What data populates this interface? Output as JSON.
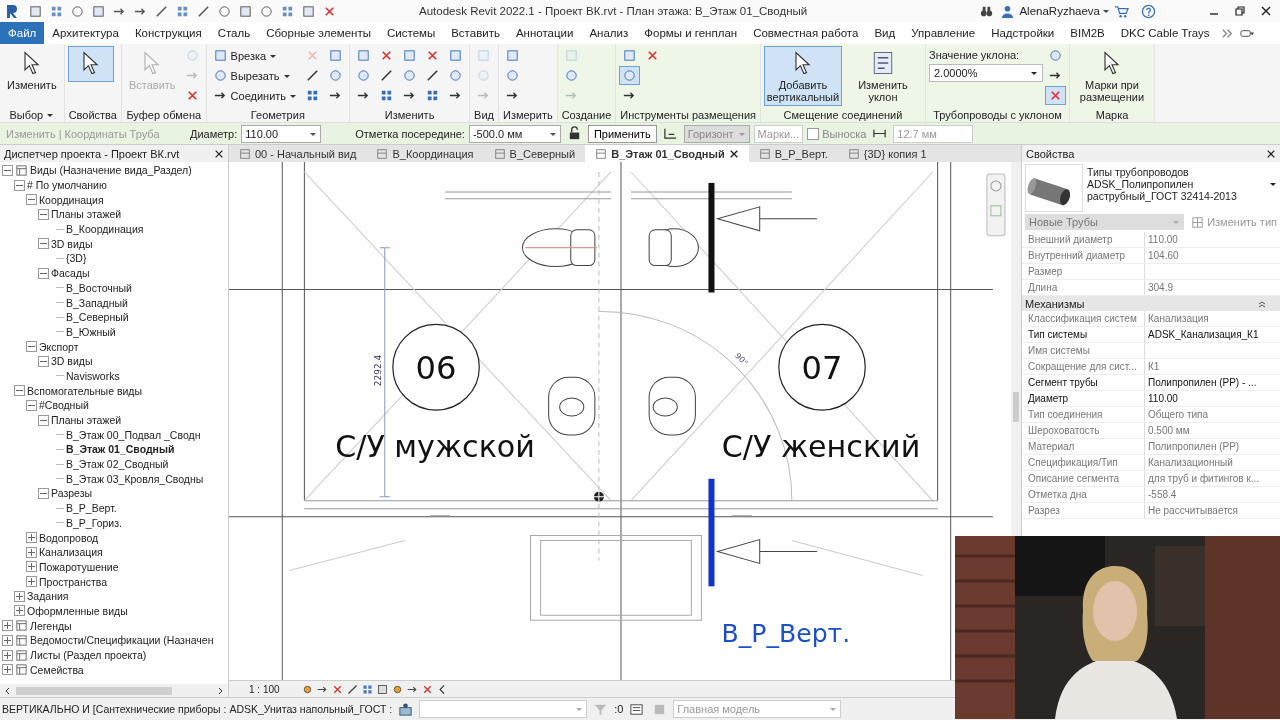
{
  "title_bar": {
    "title": "Autodesk Revit 2022.1 - Проект ВК.rvt - План этажа: В_Этаж 01_Сводный",
    "user": "AlenaRyzhaeva"
  },
  "menu_tabs": [
    {
      "label": "Файл",
      "selected": true
    },
    {
      "label": "Архитектура",
      "selected": false
    },
    {
      "label": "Конструкция",
      "selected": false
    },
    {
      "label": "Сталь",
      "selected": false
    },
    {
      "label": "Сборные элементы",
      "selected": false
    },
    {
      "label": "Системы",
      "selected": false
    },
    {
      "label": "Вставить",
      "selected": false
    },
    {
      "label": "Аннотации",
      "selected": false
    },
    {
      "label": "Анализ",
      "selected": false
    },
    {
      "label": "Формы и генплан",
      "selected": false
    },
    {
      "label": "Совместная работа",
      "selected": false
    },
    {
      "label": "Вид",
      "selected": false
    },
    {
      "label": "Управление",
      "selected": false
    },
    {
      "label": "Надстройки",
      "selected": false
    },
    {
      "label": "BIM2B",
      "selected": false
    },
    {
      "label": "DKC Cable Trays",
      "selected": false
    }
  ],
  "ribbon": {
    "panels": [
      {
        "label": "Выбор",
        "menu": true,
        "contextual": false,
        "tools": [
          {
            "kind": "large",
            "label": "Изменить",
            "selected": false,
            "disabled": false
          }
        ]
      },
      {
        "label": "Свойства",
        "menu": false,
        "contextual": false,
        "tools": [
          {
            "kind": "large",
            "selected": true,
            "disabled": false
          }
        ]
      },
      {
        "label": "Буфер обмена",
        "menu": false,
        "contextual": false,
        "tools": [
          {
            "kind": "large",
            "label": "Вставить",
            "selected": false,
            "disabled": true
          },
          {
            "kind": "icon",
            "selected": false,
            "disabled": true
          },
          {
            "kind": "icon",
            "selected": false,
            "disabled": true
          },
          {
            "kind": "icon",
            "selected": false,
            "disabled": false
          }
        ]
      },
      {
        "label": "Геометрия",
        "menu": false,
        "contextual": false,
        "tools": [
          {
            "kind": "small",
            "label": "Врезка",
            "selected": false,
            "disabled": false
          },
          {
            "kind": "small",
            "label": "Вырезать",
            "selected": false,
            "disabled": false
          },
          {
            "kind": "small",
            "label": "Соединить",
            "selected": false,
            "disabled": false
          },
          {
            "kind": "icon",
            "selected": false,
            "disabled": true
          },
          {
            "kind": "icon",
            "selected": false,
            "disabled": false
          },
          {
            "kind": "icon",
            "selected": false,
            "disabled": false
          },
          {
            "kind": "icon",
            "selected": false,
            "disabled": false
          },
          {
            "kind": "icon",
            "selected": false,
            "disabled": false
          },
          {
            "kind": "icon",
            "selected": false,
            "disabled": false
          }
        ]
      },
      {
        "label": "Изменить",
        "menu": false,
        "contextual": false,
        "tools": [
          {
            "kind": "icon",
            "selected": false,
            "disabled": false
          },
          {
            "kind": "icon",
            "selected": false,
            "disabled": false
          },
          {
            "kind": "icon",
            "selected": false,
            "disabled": false
          },
          {
            "kind": "icon",
            "selected": false,
            "disabled": false
          },
          {
            "kind": "icon",
            "selected": false,
            "disabled": false
          },
          {
            "kind": "icon",
            "selected": false,
            "disabled": false
          },
          {
            "kind": "icon",
            "selected": false,
            "disabled": false
          },
          {
            "kind": "icon",
            "selected": false,
            "disabled": false
          },
          {
            "kind": "icon",
            "selected": false,
            "disabled": false
          },
          {
            "kind": "icon",
            "selected": false,
            "disabled": false
          },
          {
            "kind": "icon",
            "selected": false,
            "disabled": false
          },
          {
            "kind": "icon",
            "selected": false,
            "disabled": false
          },
          {
            "kind": "icon",
            "selected": false,
            "disabled": false
          },
          {
            "kind": "icon",
            "selected": false,
            "disabled": false
          },
          {
            "kind": "icon",
            "selected": false,
            "disabled": false
          }
        ]
      },
      {
        "label": "Вид",
        "menu": false,
        "contextual": false,
        "tools": [
          {
            "kind": "icon",
            "selected": false,
            "disabled": true
          },
          {
            "kind": "icon",
            "selected": false,
            "disabled": true
          },
          {
            "kind": "icon",
            "selected": false,
            "disabled": true
          }
        ]
      },
      {
        "label": "Измерить",
        "menu": false,
        "contextual": false,
        "tools": [
          {
            "kind": "icon",
            "selected": false,
            "disabled": false
          },
          {
            "kind": "icon",
            "selected": false,
            "disabled": false
          },
          {
            "kind": "icon",
            "selected": false,
            "disabled": false
          }
        ]
      },
      {
        "label": "Создание",
        "menu": false,
        "contextual": true,
        "tools": [
          {
            "kind": "icon",
            "selected": false,
            "disabled": true
          },
          {
            "kind": "icon",
            "selected": false,
            "disabled": false
          },
          {
            "kind": "icon",
            "selected": false,
            "disabled": true
          }
        ]
      },
      {
        "label": "Инструменты размещения",
        "menu": false,
        "contextual": true,
        "tools": [
          {
            "kind": "icon",
            "selected": false,
            "disabled": false
          },
          {
            "kind": "icon",
            "selected": true,
            "disabled": false
          },
          {
            "kind": "icon",
            "selected": false,
            "disabled": false
          },
          {
            "kind": "icon",
            "selected": false,
            "disabled": false
          }
        ]
      },
      {
        "label": "Смещение соединений",
        "menu": false,
        "contextual": true,
        "tools": [
          {
            "kind": "large",
            "label": "Добавить вертикальный",
            "selected": true,
            "disabled": false
          },
          {
            "kind": "large",
            "label": "Изменить уклон",
            "selected": false,
            "disabled": false
          }
        ]
      },
      {
        "label": "Трубопроводы с уклоном",
        "menu": false,
        "contextual": true,
        "tools": [
          {
            "kind": "slope",
            "label": "Значение уклона:",
            "value": "2.0000%"
          },
          {
            "kind": "icon",
            "selected": false,
            "disabled": false
          },
          {
            "kind": "icon",
            "selected": false,
            "disabled": false
          },
          {
            "kind": "icon",
            "selected": true,
            "disabled": false
          }
        ]
      },
      {
        "label": "Марка",
        "menu": false,
        "contextual": true,
        "tools": [
          {
            "kind": "large",
            "label": "Марки при размещении",
            "selected": false,
            "disabled": false
          }
        ]
      }
    ]
  },
  "options_bar": {
    "context": "Изменить | Координаты Труба",
    "diameter_label": "Диаметр:",
    "diameter": "110.00",
    "offset_label": "Отметка посередине:",
    "offset": "-500.0 мм",
    "apply": "Применить",
    "justification": "Горизонт",
    "tags": "Марки...",
    "leader_label": "Выноска",
    "leader": false,
    "leader_length": "12.7 мм"
  },
  "browser": {
    "title": "Диспетчер проекта - Проект ВК.rvt",
    "tree": [
      {
        "label": "Виды (Назначение вида_Раздел)",
        "expanded": true,
        "selected": false,
        "children": [
          {
            "label": "# По умолчанию",
            "expanded": true,
            "selected": false,
            "children": [
              {
                "label": "Координация",
                "expanded": true,
                "selected": false,
                "children": [
                  {
                    "label": "Планы этажей",
                    "expanded": true,
                    "selected": false,
                    "children": [
                      {
                        "label": "В_Координация",
                        "selected": false
                      }
                    ]
                  },
                  {
                    "label": "3D виды",
                    "expanded": true,
                    "selected": false,
                    "children": [
                      {
                        "label": "{3D}",
                        "selected": false
                      }
                    ]
                  },
                  {
                    "label": "Фасады",
                    "expanded": true,
                    "selected": false,
                    "children": [
                      {
                        "label": "В_Восточный",
                        "selected": false
                      },
                      {
                        "label": "В_Западный",
                        "selected": false
                      },
                      {
                        "label": "В_Северный",
                        "selected": false
                      },
                      {
                        "label": "В_Южный",
                        "selected": false
                      }
                    ]
                  }
                ]
              },
              {
                "label": "Экспорт",
                "expanded": true,
                "selected": false,
                "children": [
                  {
                    "label": "3D виды",
                    "expanded": true,
                    "selected": false,
                    "children": [
                      {
                        "label": "Navisworks",
                        "selected": false
                      }
                    ]
                  }
                ]
              }
            ]
          },
          {
            "label": "Вспомогательные виды",
            "expanded": true,
            "selected": false,
            "children": [
              {
                "label": "#Сводный",
                "expanded": true,
                "selected": false,
                "children": [
                  {
                    "label": "Планы этажей",
                    "expanded": true,
                    "selected": false,
                    "children": [
                      {
                        "label": "В_Этаж 00_Подвал _Сводн",
                        "selected": false
                      },
                      {
                        "label": "В_Этаж 01_Сводный",
                        "selected": true
                      },
                      {
                        "label": "В_Этаж 02_Сводный",
                        "selected": false
                      },
                      {
                        "label": "В_Этаж 03_Кровля_Сводны",
                        "selected": false
                      }
                    ]
                  },
                  {
                    "label": "Разрезы",
                    "expanded": true,
                    "selected": false,
                    "children": [
                      {
                        "label": "В_Р_Верт.",
                        "selected": false
                      },
                      {
                        "label": "В_Р_Гориз.",
                        "selected": false
                      }
                    ]
                  }
                ]
              },
              {
                "label": "Водопровод",
                "expanded": false,
                "selected": false
              },
              {
                "label": "Канализация",
                "expanded": false,
                "selected": false
              },
              {
                "label": "Пожаротушение",
                "expanded": false,
                "selected": false
              },
              {
                "label": "Пространства",
                "expanded": false,
                "selected": false
              }
            ]
          },
          {
            "label": "Задания",
            "expanded": false,
            "selected": false
          },
          {
            "label": "Оформленные виды",
            "expanded": false,
            "selected": false
          }
        ]
      },
      {
        "label": "Легенды",
        "expanded": false,
        "selected": false
      },
      {
        "label": "Ведомости/Спецификации (Назначен",
        "expanded": false,
        "selected": false
      },
      {
        "label": "Листы (Раздел проекта)",
        "expanded": false,
        "selected": false
      },
      {
        "label": "Семейства",
        "expanded": false,
        "selected": false
      }
    ]
  },
  "view_tabs": [
    {
      "label": "00 - Начальный вид",
      "selected": false
    },
    {
      "label": "В_Координация",
      "selected": false
    },
    {
      "label": "В_Северный",
      "selected": false
    },
    {
      "label": "В_Этаж 01_Сводный",
      "selected": true
    },
    {
      "label": "В_Р_Верт.",
      "selected": false
    },
    {
      "label": "{3D} копия 1",
      "selected": false
    }
  ],
  "plan": {
    "rooms": [
      {
        "number": "06",
        "name": "С/У мужской"
      },
      {
        "number": "07",
        "name": "С/У женский"
      }
    ],
    "dimension": "2292.4",
    "angle": "90°",
    "section_label": "В_Р_Верт."
  },
  "view_control": {
    "scale": "1 : 100"
  },
  "properties": {
    "title": "Свойства",
    "type_family": "Типы трубопроводов",
    "type_name": "ADSK_Полипропилен раструбный_ГОСТ 32414-2013",
    "filter": "Новые Трубы",
    "edit_type": "Изменить тип",
    "rows": [
      {
        "kind": "param",
        "label": "Внешний диаметр",
        "value": "110.00",
        "editable": false
      },
      {
        "kind": "param",
        "label": "Внутренний диаметр",
        "value": "104.60",
        "editable": false
      },
      {
        "kind": "param",
        "label": "Размер",
        "editable": false
      },
      {
        "kind": "param",
        "label": "Длина",
        "value": "304.9",
        "editable": false
      },
      {
        "kind": "section",
        "label": "Механизмы"
      },
      {
        "kind": "param",
        "label": "Классификация систем",
        "value": "Канализация",
        "editable": false
      },
      {
        "kind": "param",
        "label": "Тип системы",
        "value": "ADSK_Канализация_К1",
        "editable": true
      },
      {
        "kind": "param",
        "label": "Имя системы",
        "editable": false
      },
      {
        "kind": "param",
        "label": "Сокращение для сист...",
        "value": "К1",
        "editable": false
      },
      {
        "kind": "param",
        "label": "Сегмент трубы",
        "value": "Полипропилен (PP) - ...",
        "editable": true
      },
      {
        "kind": "param",
        "label": "Диаметр",
        "value": "110.00",
        "editable": true
      },
      {
        "kind": "param",
        "label": "Тип соединения",
        "value": "Общего типа",
        "editable": false
      },
      {
        "kind": "param",
        "label": "Шероховатость",
        "value": "0.500 мм",
        "editable": false
      },
      {
        "kind": "param",
        "label": "Материал",
        "value": "Полипропилен (PP)",
        "editable": false
      },
      {
        "kind": "param",
        "label": "Спецификация/Тип",
        "value": "Канализационный",
        "editable": false
      },
      {
        "kind": "param",
        "label": "Описание сегмента",
        "value": "для труб и фитингов к...",
        "editable": false
      },
      {
        "kind": "param",
        "label": "Отметка дна",
        "value": "-558.4",
        "editable": false
      },
      {
        "kind": "param",
        "label": "Разрез",
        "value": "Не рассчитывается",
        "editable": false
      }
    ]
  },
  "status_bar": {
    "message": "ВЕРТИКАЛЬНО И [Сантехнические приборы : ADSK_Унитаз напольный_ГОСТ :",
    "filter_count": ":0",
    "design_option": "Главная модель"
  }
}
